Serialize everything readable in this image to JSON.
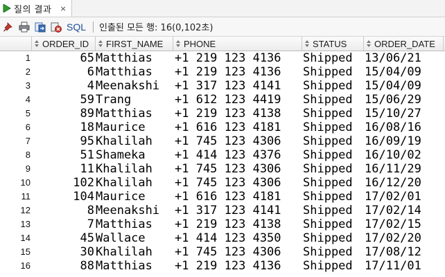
{
  "tab": {
    "label": "질의 결과",
    "close": "×"
  },
  "toolbar": {
    "sql_label": "SQL",
    "status_text": "인출된 모든 행: 16(0,102초)"
  },
  "columns": [
    "ORDER_ID",
    "FIRST_NAME",
    "PHONE",
    "STATUS",
    "ORDER_DATE"
  ],
  "rows": [
    {
      "n": "1",
      "order_id": "65",
      "first_name": "Matthias",
      "phone": "+1 219 123 4136",
      "status": "Shipped",
      "order_date": "13/06/21"
    },
    {
      "n": "2",
      "order_id": "6",
      "first_name": "Matthias",
      "phone": "+1 219 123 4136",
      "status": "Shipped",
      "order_date": "15/04/09"
    },
    {
      "n": "3",
      "order_id": "4",
      "first_name": "Meenakshi",
      "phone": "+1 317 123 4141",
      "status": "Shipped",
      "order_date": "15/04/09"
    },
    {
      "n": "4",
      "order_id": "59",
      "first_name": "Trang",
      "phone": "+1 612 123 4419",
      "status": "Shipped",
      "order_date": "15/06/29"
    },
    {
      "n": "5",
      "order_id": "89",
      "first_name": "Matthias",
      "phone": "+1 219 123 4138",
      "status": "Shipped",
      "order_date": "15/10/27"
    },
    {
      "n": "6",
      "order_id": "18",
      "first_name": "Maurice",
      "phone": "+1 616 123 4181",
      "status": "Shipped",
      "order_date": "16/08/16"
    },
    {
      "n": "7",
      "order_id": "95",
      "first_name": "Khalilah",
      "phone": "+1 745 123 4306",
      "status": "Shipped",
      "order_date": "16/09/19"
    },
    {
      "n": "8",
      "order_id": "51",
      "first_name": "Shameka",
      "phone": "+1 414 123 4376",
      "status": "Shipped",
      "order_date": "16/10/02"
    },
    {
      "n": "9",
      "order_id": "11",
      "first_name": "Khalilah",
      "phone": "+1 745 123 4306",
      "status": "Shipped",
      "order_date": "16/11/29"
    },
    {
      "n": "10",
      "order_id": "102",
      "first_name": "Khalilah",
      "phone": "+1 745 123 4306",
      "status": "Shipped",
      "order_date": "16/12/20"
    },
    {
      "n": "11",
      "order_id": "104",
      "first_name": "Maurice",
      "phone": "+1 616 123 4181",
      "status": "Shipped",
      "order_date": "17/02/01"
    },
    {
      "n": "12",
      "order_id": "8",
      "first_name": "Meenakshi",
      "phone": "+1 317 123 4141",
      "status": "Shipped",
      "order_date": "17/02/14"
    },
    {
      "n": "13",
      "order_id": "7",
      "first_name": "Matthias",
      "phone": "+1 219 123 4138",
      "status": "Shipped",
      "order_date": "17/02/15"
    },
    {
      "n": "14",
      "order_id": "45",
      "first_name": "Wallace",
      "phone": "+1 414 123 4350",
      "status": "Shipped",
      "order_date": "17/02/20"
    },
    {
      "n": "15",
      "order_id": "30",
      "first_name": "Khalilah",
      "phone": "+1 745 123 4306",
      "status": "Shipped",
      "order_date": "17/08/12"
    },
    {
      "n": "16",
      "order_id": "88",
      "first_name": "Matthias",
      "phone": "+1 219 123 4136",
      "status": "Shipped",
      "order_date": "17/11/01"
    }
  ],
  "icons": {
    "tab": "run-green-icon",
    "toolbar": [
      "pin-icon",
      "print-icon",
      "export-icon",
      "delete-icon"
    ],
    "sort": "sort-icon"
  },
  "colors": {
    "sql_text": "#1a4d9c",
    "run_icon": "#2e9e2e",
    "pin_icon": "#c0392b"
  }
}
